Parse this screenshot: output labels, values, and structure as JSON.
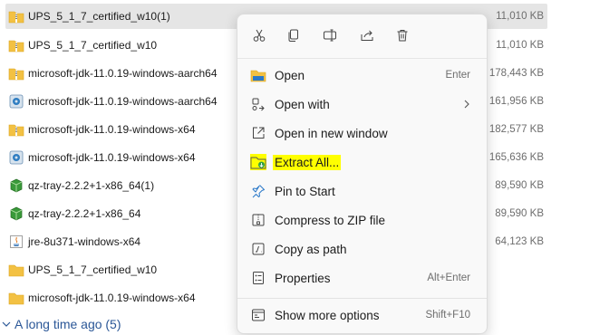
{
  "files": [
    {
      "name": "UPS_5_1_7_certified_w10(1)",
      "size": "11,010 KB",
      "icon": "zip-folder-icon",
      "selected": true
    },
    {
      "name": "UPS_5_1_7_certified_w10",
      "size": "11,010 KB",
      "icon": "zip-folder-icon"
    },
    {
      "name": "microsoft-jdk-11.0.19-windows-aarch64",
      "size": "178,443 KB",
      "icon": "zip-folder-icon"
    },
    {
      "name": "microsoft-jdk-11.0.19-windows-aarch64",
      "size": "161,956 KB",
      "icon": "installer-icon"
    },
    {
      "name": "microsoft-jdk-11.0.19-windows-x64",
      "size": "182,577 KB",
      "icon": "zip-folder-icon"
    },
    {
      "name": "microsoft-jdk-11.0.19-windows-x64",
      "size": "165,636 KB",
      "icon": "installer-icon"
    },
    {
      "name": "qz-tray-2.2.2+1-x86_64(1)",
      "size": "89,590 KB",
      "icon": "package-icon"
    },
    {
      "name": "qz-tray-2.2.2+1-x86_64",
      "size": "89,590 KB",
      "icon": "package-icon"
    },
    {
      "name": "jre-8u371-windows-x64",
      "size": "64,123 KB",
      "icon": "java-app-icon"
    },
    {
      "name": "UPS_5_1_7_certified_w10",
      "size": "",
      "icon": "folder-icon"
    },
    {
      "name": "microsoft-jdk-11.0.19-windows-x64",
      "size": "",
      "icon": "folder-icon"
    }
  ],
  "group_header": {
    "label": "A long time ago (5)",
    "icon": "chevron-down-icon"
  },
  "context_menu": {
    "toolbar": [
      {
        "name": "cut-button",
        "icon": "scissors-icon"
      },
      {
        "name": "copy-button",
        "icon": "copy-icon"
      },
      {
        "name": "rename-button",
        "icon": "rename-icon"
      },
      {
        "name": "share-button",
        "icon": "share-icon"
      },
      {
        "name": "delete-button",
        "icon": "trash-icon"
      }
    ],
    "items": [
      {
        "label": "Open",
        "shortcut": "Enter",
        "icon": "folder-open-icon"
      },
      {
        "label": "Open with",
        "shortcut": "",
        "icon": "open-with-icon",
        "submenu": true
      },
      {
        "label": "Open in new window",
        "shortcut": "",
        "icon": "new-window-icon"
      },
      {
        "label": "Extract All...",
        "shortcut": "",
        "icon": "extract-icon",
        "highlighted": true
      },
      {
        "label": "Pin to Start",
        "shortcut": "",
        "icon": "pin-icon"
      },
      {
        "label": "Compress to ZIP file",
        "shortcut": "",
        "icon": "zip-compress-icon"
      },
      {
        "label": "Copy as path",
        "shortcut": "",
        "icon": "copy-path-icon"
      },
      {
        "label": "Properties",
        "shortcut": "Alt+Enter",
        "icon": "properties-icon"
      },
      {
        "label": "Show more options",
        "shortcut": "Shift+F10",
        "icon": "more-options-icon"
      }
    ]
  },
  "colors": {
    "highlight": "#ffff00",
    "selection": "#e5e5e5",
    "folder": "#f3c143",
    "accent": "#0067c0"
  }
}
